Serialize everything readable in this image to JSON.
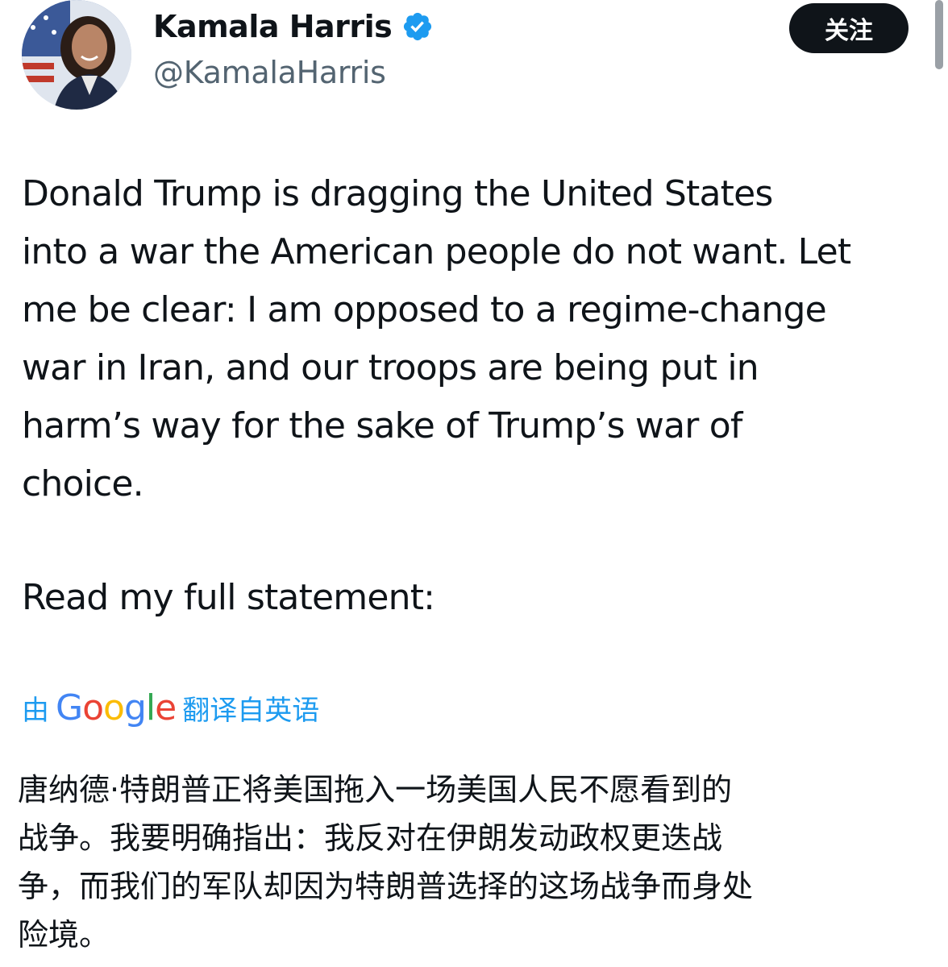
{
  "header": {
    "display_name": "Kamala Harris",
    "handle": "@KamalaHarris",
    "follow_label": "关注",
    "verified_icon": "verified-badge-icon",
    "verified_color": "#1d9bf0"
  },
  "tweet": {
    "lines": [
      "Donald Trump is dragging the United States",
      "into a war the American people do not want. Let",
      "me be clear: I am opposed to a regime-change",
      "war in Iran, and our troops are being put in",
      "harm’s way for the sake of Trump’s war of",
      "choice."
    ],
    "cta": "Read my full statement:"
  },
  "translation": {
    "prefix": "由",
    "provider": "Google",
    "suffix": "翻译自英语",
    "link_color": "#1d9bf0",
    "lines": [
      "唐纳德·特朗普正将美国拖入一场美国人民不愿看到的",
      "战争。我要明确指出：我反对在伊朗发动政权更迭战",
      "争，而我们的军队却因为特朗普选择的这场战争而身处",
      "险境。"
    ]
  }
}
